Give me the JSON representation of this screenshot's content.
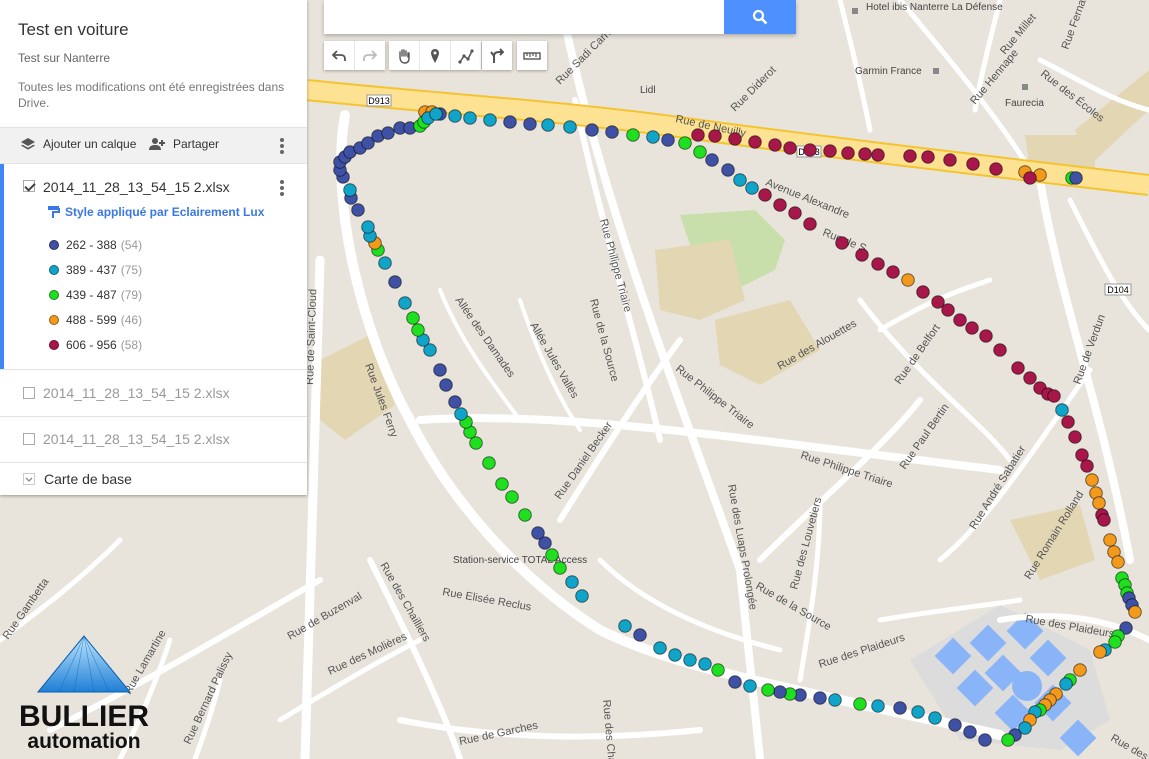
{
  "map_title": "Test en voiture",
  "map_description": "Test sur Nanterre",
  "save_status": "Toutes les modifications ont été enregistrées dans Drive.",
  "actions": {
    "add_layer": "Ajouter un calque",
    "share": "Partager"
  },
  "search": {
    "placeholder": "",
    "value": ""
  },
  "layers": [
    {
      "name": "2014_11_28_13_54_15 2.xlsx",
      "checked": true,
      "style_label": "Style appliqué par Eclairement Lux"
    },
    {
      "name": "2014_11_28_13_54_15 2.xlsx",
      "checked": false
    },
    {
      "name": "2014_11_28_13_54_15 2.xlsx",
      "checked": false
    }
  ],
  "legend": [
    {
      "range": "262 - 388",
      "count": "(54)",
      "color": "#3f51a5"
    },
    {
      "range": "389 - 437",
      "count": "(75)",
      "color": "#10a4c8"
    },
    {
      "range": "439 - 487",
      "count": "(79)",
      "color": "#1ee01e"
    },
    {
      "range": "488 - 599",
      "count": "(46)",
      "color": "#f39a1d"
    },
    {
      "range": "606 - 956",
      "count": "(58)",
      "color": "#a8174a"
    }
  ],
  "basemap_label": "Carte de base",
  "logo": {
    "line1": "BULLIER",
    "line2": "automation"
  },
  "map_labels": {
    "hotel": "Hotel ibis Nanterre La Défense",
    "garmin": "Garmin France",
    "faurecia": "Faurecia",
    "lidl": "Lidl",
    "total": "Station-service TOTAL Access",
    "d913a": "D913",
    "d913b": "D913",
    "d104": "D104",
    "streets": {
      "sadi_carnot": "Rue Sadi Carnot",
      "diderot": "Rue Diderot",
      "neuilly": "Rue de Neuilly",
      "alexandre": "Avenue Alexandre",
      "philippe_triaire_v": "Rue Philippe Triaire",
      "source": "Rue de la Source",
      "philippe_triaire_h": "Rue Philippe Triaire",
      "alouettes": "Rue des Alouettes",
      "belfort": "Rue de Belfort",
      "verdun": "Rue de Verdun",
      "paul_bertin": "Rue Paul Bertin",
      "andre_sabatier": "Rue André Sabatier",
      "romain_rolland": "Rue Romain Rolland",
      "plaideurs": "Rue des Plaideurs",
      "plaideurs2": "Rue des Plaideurs",
      "saint_cloud": "Rue de Saint-Cloud",
      "jules_ferry": "Rue Jules Ferry",
      "damades": "Allée des Damades",
      "jules_valles": "Allée Jules Vallès",
      "daniel_becker": "Rue Daniel Becker",
      "luaps": "Rue des Luaps Prolongée",
      "louvetiers": "Rue des Louvetiers",
      "source2": "Rue de la Source",
      "elisee_reclus": "Rue Elisée Reclus",
      "buzenval": "Rue de Buzenval",
      "molieres": "Rue des Molières",
      "chailliers": "Rue des Chailliers",
      "chailliers2": "Rue des Chailliers",
      "gambetta": "Rue Gambetta",
      "lamartine": "Rue Lamartine",
      "palissy": "Rue Bernard Palissy",
      "garches": "Rue de Garches",
      "millet": "Rue Millet",
      "hennape": "Rue Hennape",
      "ecoles": "Rue des Écoles",
      "leger": "Rue Fernand Léger",
      "rue_de_s": "Rue de S",
      "rue_des_co": "Rue des Co"
    }
  }
}
